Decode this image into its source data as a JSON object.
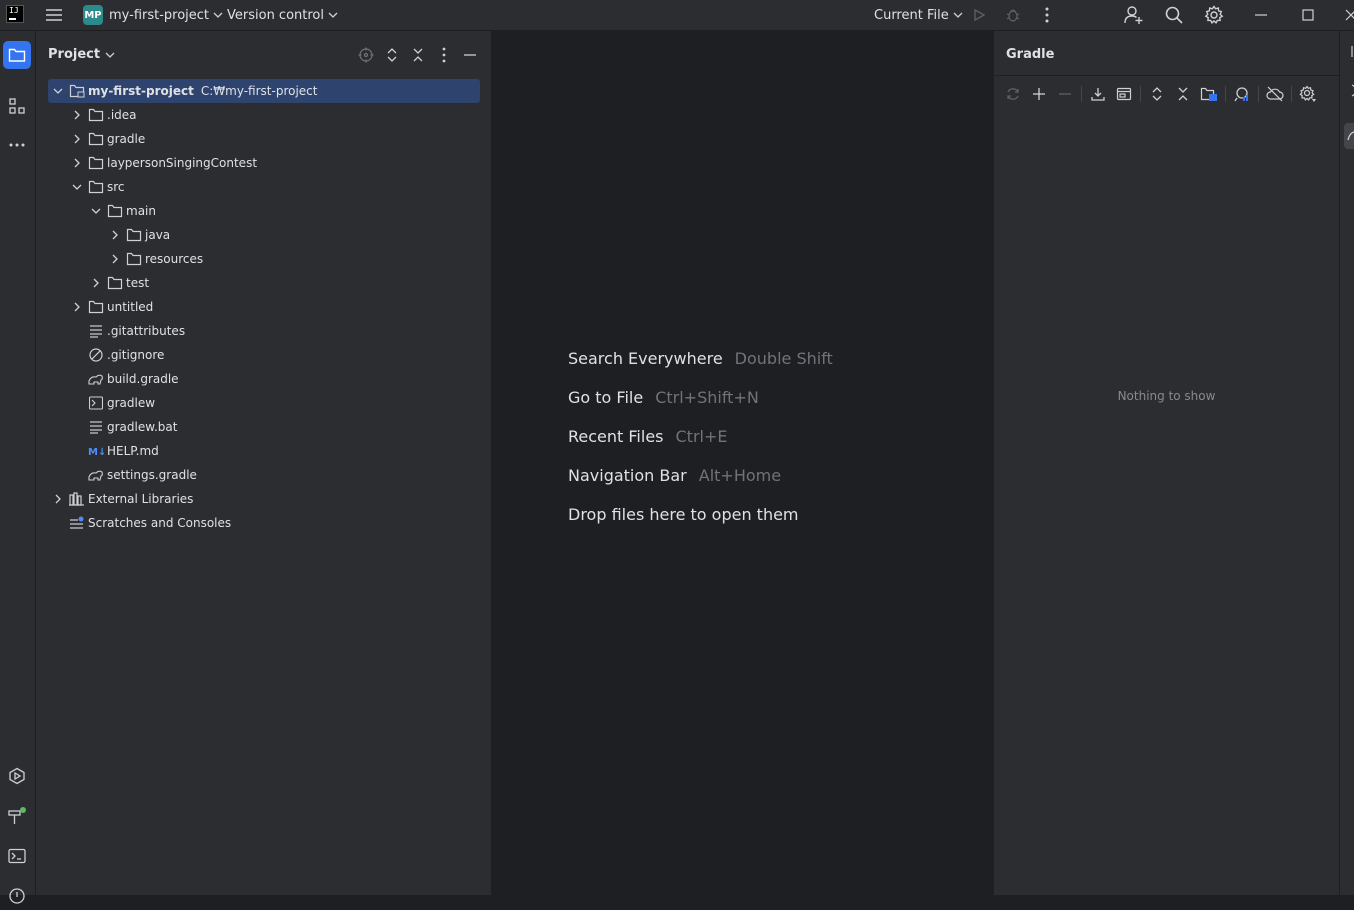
{
  "titlebar": {
    "logo_text": "IJ",
    "project_badge": "MP",
    "project_name": "my-first-project",
    "vcs": "Version control",
    "run_config": "Current File"
  },
  "project_panel": {
    "title": "Project",
    "tree": [
      {
        "label": "my-first-project",
        "path": "C:₩my-first-project",
        "type": "module",
        "depth": 0,
        "expanded": true,
        "selected": true
      },
      {
        "label": ".idea",
        "type": "folder",
        "depth": 1,
        "expanded": false
      },
      {
        "label": "gradle",
        "type": "folder",
        "depth": 1,
        "expanded": false
      },
      {
        "label": "laypersonSingingContest",
        "type": "folder",
        "depth": 1,
        "expanded": false
      },
      {
        "label": "src",
        "type": "folder",
        "depth": 1,
        "expanded": true
      },
      {
        "label": "main",
        "type": "folder",
        "depth": 2,
        "expanded": true
      },
      {
        "label": "java",
        "type": "folder",
        "depth": 3,
        "expanded": false
      },
      {
        "label": "resources",
        "type": "folder",
        "depth": 3,
        "expanded": false
      },
      {
        "label": "test",
        "type": "folder",
        "depth": 2,
        "expanded": false
      },
      {
        "label": "untitled",
        "type": "folder",
        "depth": 1,
        "expanded": false
      },
      {
        "label": ".gitattributes",
        "type": "text",
        "depth": 1
      },
      {
        "label": ".gitignore",
        "type": "ignore",
        "depth": 1
      },
      {
        "label": "build.gradle",
        "type": "gradle",
        "depth": 1
      },
      {
        "label": "gradlew",
        "type": "shell",
        "depth": 1
      },
      {
        "label": "gradlew.bat",
        "type": "text",
        "depth": 1
      },
      {
        "label": "HELP.md",
        "type": "markdown",
        "depth": 1
      },
      {
        "label": "settings.gradle",
        "type": "gradle",
        "depth": 1
      },
      {
        "label": "External Libraries",
        "type": "libraries",
        "depth": 0,
        "expanded": false
      },
      {
        "label": "Scratches and Consoles",
        "type": "scratches",
        "depth": 0
      }
    ]
  },
  "editor": {
    "hints": [
      {
        "action": "Search Everywhere",
        "shortcut": "Double Shift"
      },
      {
        "action": "Go to File",
        "shortcut": "Ctrl+Shift+N"
      },
      {
        "action": "Recent Files",
        "shortcut": "Ctrl+E"
      },
      {
        "action": "Navigation Bar",
        "shortcut": "Alt+Home"
      },
      {
        "action": "Drop files here to open them",
        "shortcut": ""
      }
    ]
  },
  "gradle_panel": {
    "title": "Gradle",
    "empty_text": "Nothing to show"
  },
  "colors": {
    "accent": "#3574f0",
    "selection": "#2e436e",
    "panel_bg": "#2b2d30",
    "editor_bg": "#1e1f22"
  }
}
